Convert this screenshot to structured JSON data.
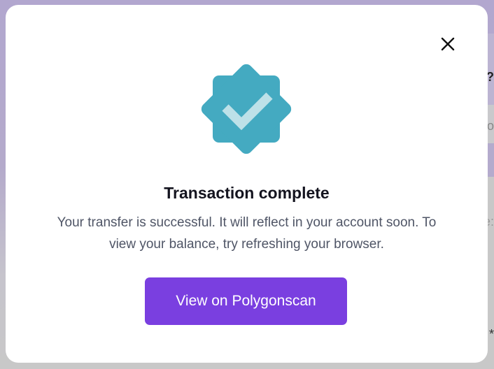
{
  "background": {
    "fragments": [
      "?",
      "o",
      "e:",
      "*"
    ]
  },
  "modal": {
    "close_icon": "close-icon",
    "badge_icon": "verified-check-badge-icon",
    "title": "Transaction complete",
    "description": "Your transfer is successful. It will reflect in your account soon. To view your balance, try refreshing your browser.",
    "button_label": "View on Polygonscan"
  },
  "colors": {
    "badge": "#44aac1",
    "check": "#bde1e8",
    "button": "#7a3fe0"
  }
}
